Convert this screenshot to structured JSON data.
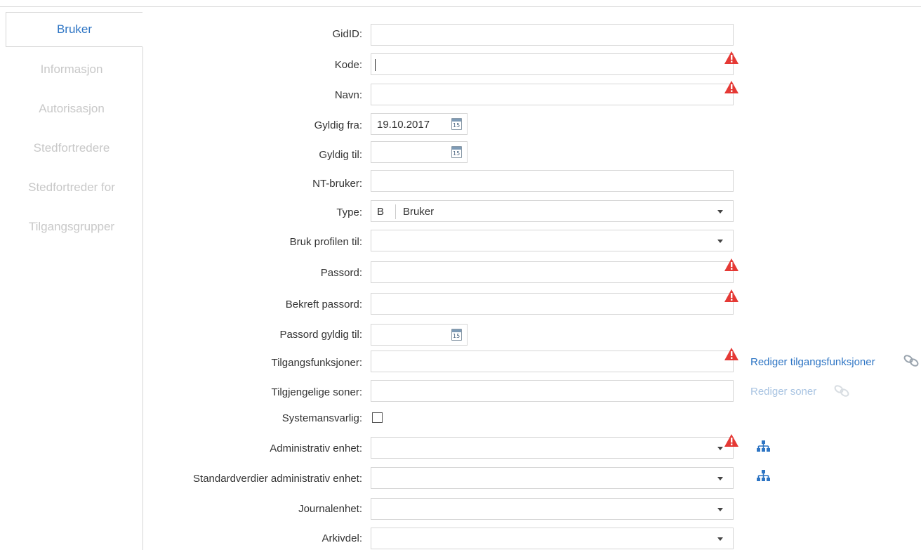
{
  "tabs": [
    {
      "label": "Bruker",
      "active": true
    },
    {
      "label": "Informasjon"
    },
    {
      "label": "Autorisasjon"
    },
    {
      "label": "Stedfortredere"
    },
    {
      "label": "Stedfortreder for"
    },
    {
      "label": "Tilgangsgrupper"
    }
  ],
  "form": {
    "gidid": {
      "label": "GidID:",
      "value": ""
    },
    "kode": {
      "label": "Kode:",
      "value": ""
    },
    "navn": {
      "label": "Navn:",
      "value": ""
    },
    "gyldig_fra": {
      "label": "Gyldig fra:",
      "value": "19.10.2017"
    },
    "gyldig_til": {
      "label": "Gyldig til:",
      "value": ""
    },
    "nt_bruker": {
      "label": "NT-bruker:",
      "value": ""
    },
    "type": {
      "label": "Type:",
      "code": "B",
      "name": "Bruker"
    },
    "bruk_profilen": {
      "label": "Bruk profilen til:",
      "value": ""
    },
    "passord": {
      "label": "Passord:",
      "value": ""
    },
    "bekreft_passord": {
      "label": "Bekreft passord:",
      "value": ""
    },
    "passord_gyldig": {
      "label": "Passord gyldig til:",
      "value": ""
    },
    "tilgangsfunksjoner": {
      "label": "Tilgangsfunksjoner:",
      "value": "",
      "link": "Rediger tilgangsfunksjoner"
    },
    "soner": {
      "label": "Tilgjengelige soner:",
      "value": "",
      "link": "Rediger soner"
    },
    "systemansvarlig": {
      "label": "Systemansvarlig:",
      "checked": false
    },
    "adm_enhet": {
      "label": "Administrativ enhet:",
      "value": ""
    },
    "std_adm_enhet": {
      "label": "Standardverdier administrativ enhet:",
      "value": ""
    },
    "journalenhet": {
      "label": "Journalenhet:",
      "value": ""
    },
    "arkivdel": {
      "label": "Arkivdel:",
      "value": ""
    }
  },
  "calendar_icon_text": "15",
  "colors": {
    "accent": "#2e75c4",
    "warning": "#e53935",
    "disabled_tab": "#c8c8c8"
  }
}
